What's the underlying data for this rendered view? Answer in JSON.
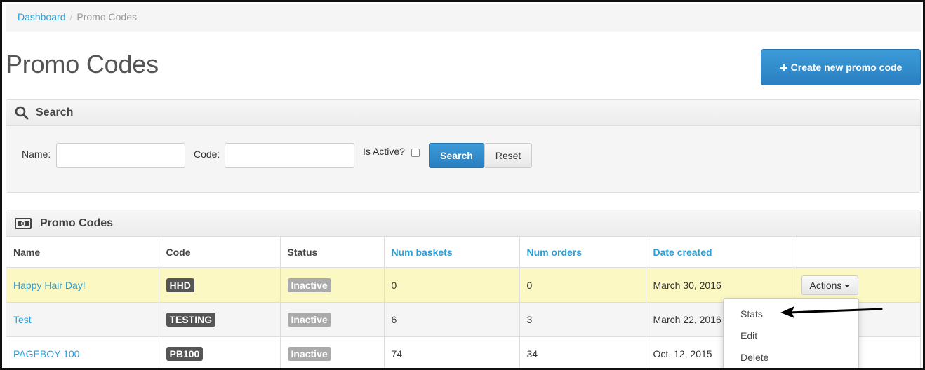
{
  "breadcrumb": {
    "home": "Dashboard",
    "separator": "/",
    "current": "Promo Codes"
  },
  "page": {
    "title": "Promo Codes",
    "create_button": "Create new promo code"
  },
  "search": {
    "heading": "Search",
    "name_label": "Name:",
    "code_label": "Code:",
    "active_label": "Is Active?",
    "search_button": "Search",
    "reset_button": "Reset"
  },
  "list": {
    "heading": "Promo Codes",
    "columns": [
      "Name",
      "Code",
      "Status",
      "Num baskets",
      "Num orders",
      "Date created",
      ""
    ],
    "rows": [
      {
        "name": "Happy Hair Day!",
        "code": "HHD",
        "status": "Inactive",
        "baskets": "0",
        "orders": "0",
        "date": "March 30, 2016"
      },
      {
        "name": "Test",
        "code": "TESTING",
        "status": "Inactive",
        "baskets": "6",
        "orders": "3",
        "date": "March 22, 2016"
      },
      {
        "name": "PAGEBOY 100",
        "code": "PB100",
        "status": "Inactive",
        "baskets": "74",
        "orders": "34",
        "date": "Oct. 12, 2015"
      }
    ],
    "actions_label": "Actions"
  },
  "dropdown": {
    "items": [
      "Stats",
      "Edit",
      "Delete"
    ]
  },
  "colors": {
    "link": "#2a9fd6",
    "primary": "#2a7fc0",
    "highlight_row": "#fcf8c3"
  }
}
